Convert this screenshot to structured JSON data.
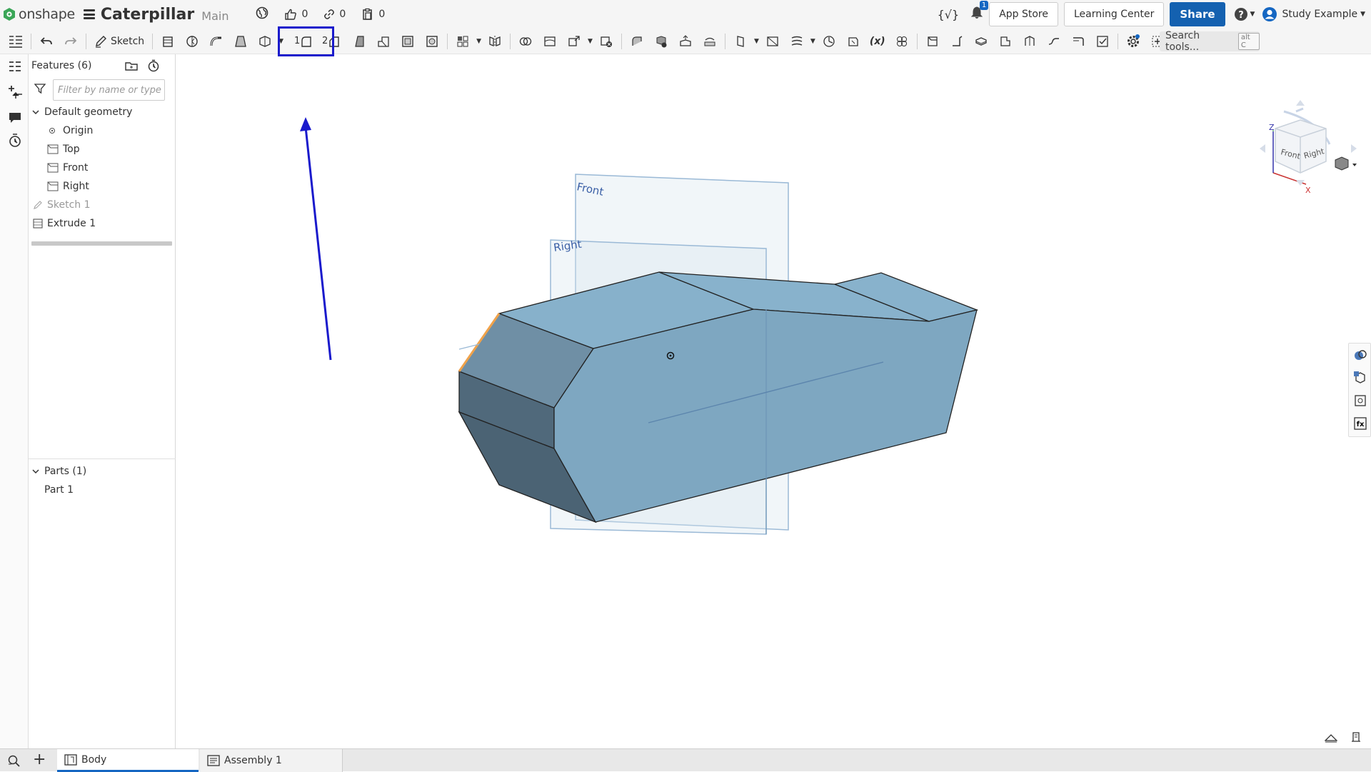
{
  "app": {
    "logo_text": "onshape",
    "doc_title": "Caterpillar",
    "branch": "Main"
  },
  "meta": {
    "likes": "0",
    "links": "0",
    "copies": "0"
  },
  "header_right": {
    "notif_count": "1",
    "app_store": "App Store",
    "learning_center": "Learning Center",
    "share": "Share",
    "user": "Study Example"
  },
  "toolbar": {
    "sketch_label": "Sketch",
    "fillet_number": "1",
    "chamfer_number": "2",
    "search_placeholder": "Search tools...",
    "search_shortcut": "alt C"
  },
  "features": {
    "title": "Features (6)",
    "filter_placeholder": "Filter by name or type",
    "default_geometry": "Default geometry",
    "items": [
      "Origin",
      "Top",
      "Front",
      "Right"
    ],
    "sketch": "Sketch 1",
    "extrude": "Extrude 1"
  },
  "parts": {
    "title": "Parts (1)",
    "items": [
      "Part 1"
    ]
  },
  "viewport": {
    "plane_front": "Front",
    "plane_right": "Right",
    "cube_front": "Front",
    "cube_right": "Right",
    "axis_z": "Z",
    "axis_x": "X"
  },
  "tabs": [
    {
      "label": "Body"
    },
    {
      "label": "Assembly 1"
    }
  ],
  "colors": {
    "accent": "#1466c2",
    "share": "#1461b0",
    "part_top": "#87b1cb",
    "part_front": "#6f8fa5",
    "part_dark": "#50697b",
    "annotation": "#1a1acc",
    "edge_highlight": "#f0a24a"
  }
}
